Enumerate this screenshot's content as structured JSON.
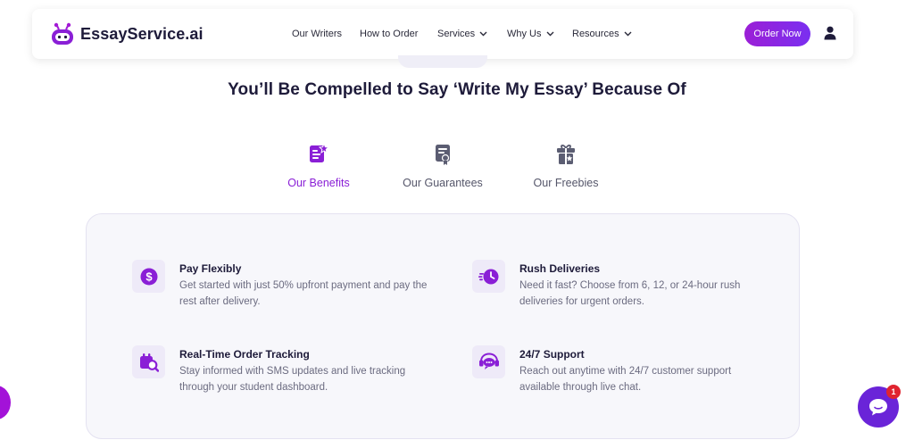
{
  "brand": {
    "name": "EssayService.ai",
    "accent": "#8a1fd6",
    "gradient_start": "#9b1fd6",
    "gradient_end": "#7a2ff0"
  },
  "nav": {
    "items": [
      {
        "label": "Our Writers",
        "dropdown": false
      },
      {
        "label": "How to Order",
        "dropdown": false
      },
      {
        "label": "Services",
        "dropdown": true
      },
      {
        "label": "Why Us",
        "dropdown": true
      },
      {
        "label": "Resources",
        "dropdown": true
      }
    ],
    "order_button": "Order Now",
    "user_icon": "user-icon"
  },
  "heading": "You’ll Be Compelled to Say ‘Write My Essay’ Because Of",
  "tabs": [
    {
      "label": "Our Benefits",
      "icon": "benefits-list-icon",
      "active": true
    },
    {
      "label": "Our Guarantees",
      "icon": "certificate-icon",
      "active": false
    },
    {
      "label": "Our Freebies",
      "icon": "gift-icon",
      "active": false
    }
  ],
  "features": [
    {
      "title": "Pay Flexibly",
      "description": "Get started with just 50% upfront payment and pay the rest after delivery.",
      "icon": "dollar-icon"
    },
    {
      "title": "Rush Deliveries",
      "description": "Need it fast? Choose from 6, 12, or 24-hour rush deliveries for urgent orders.",
      "icon": "fast-clock-icon"
    },
    {
      "title": "Real-Time Order Tracking",
      "description": "Stay informed with SMS updates and live tracking through your student dashboard.",
      "icon": "tracking-icon"
    },
    {
      "title": "24/7 Support",
      "description": "Reach out anytime with 24/7 customer support available through live chat.",
      "icon": "support-chat-icon"
    }
  ],
  "chat": {
    "badge_count": "1",
    "icon": "chat-bubble-icon"
  }
}
